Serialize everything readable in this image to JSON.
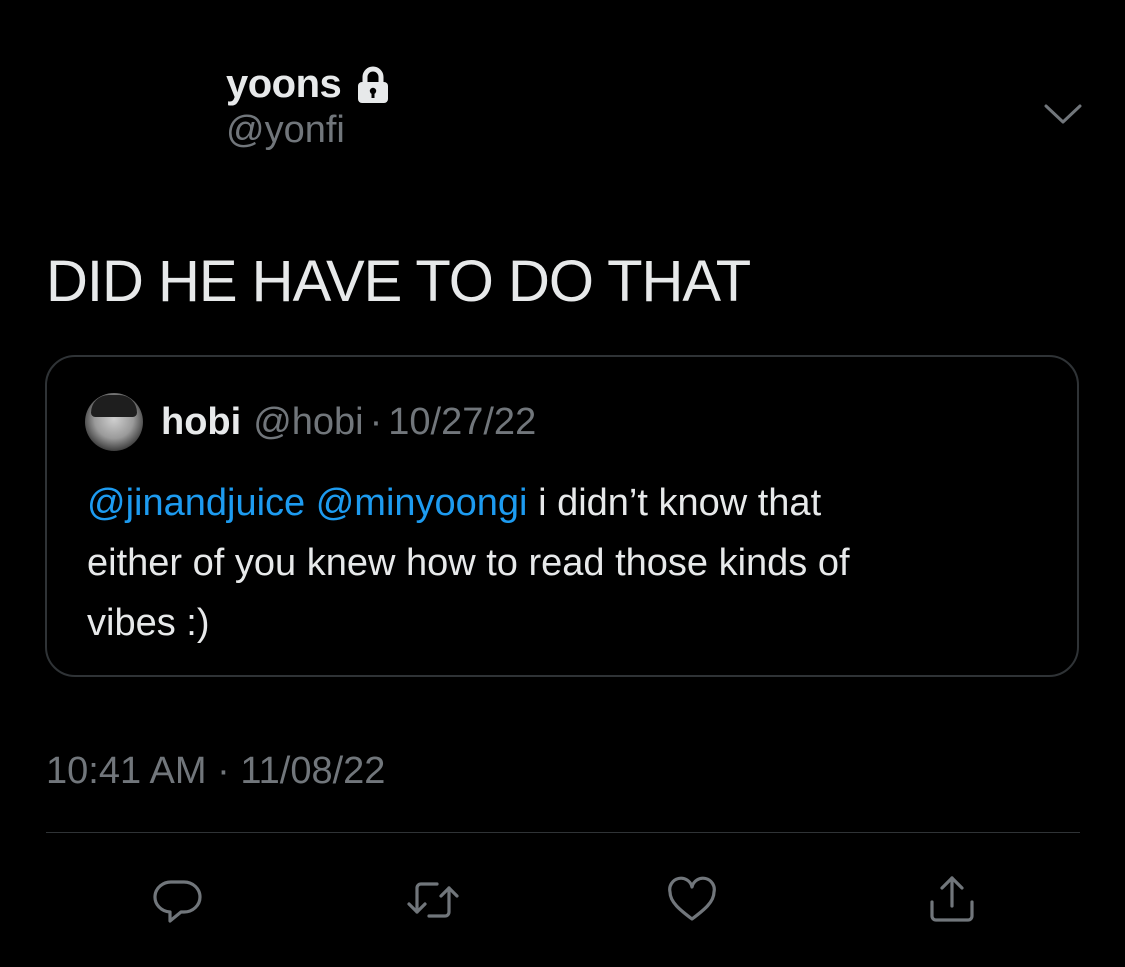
{
  "author": {
    "display_name": "yoons",
    "handle": "@yonfi",
    "protected_icon": "lock-icon"
  },
  "more_menu_icon": "chevron-down-icon",
  "tweet": {
    "text": "DID HE HAVE TO DO THAT",
    "timestamp": "10:41 AM · 11/08/22"
  },
  "quote": {
    "display_name": "hobi",
    "handle": "@hobi",
    "separator": "·",
    "date": "10/27/22",
    "mention_1": "@jinandjuice",
    "mention_2": "@minyoongi",
    "text_line_1_rest": " i didn’t know that",
    "text_line_2": "either of you knew how to read those kinds of",
    "text_line_3": "vibes :)"
  },
  "actions": {
    "reply_icon": "reply-icon",
    "retweet_icon": "retweet-icon",
    "like_icon": "heart-icon",
    "share_icon": "share-icon"
  },
  "colors": {
    "background": "#000000",
    "text": "#e7e9ea",
    "secondary": "#71767b",
    "link": "#1d9bf0",
    "border": "#2f3336"
  }
}
